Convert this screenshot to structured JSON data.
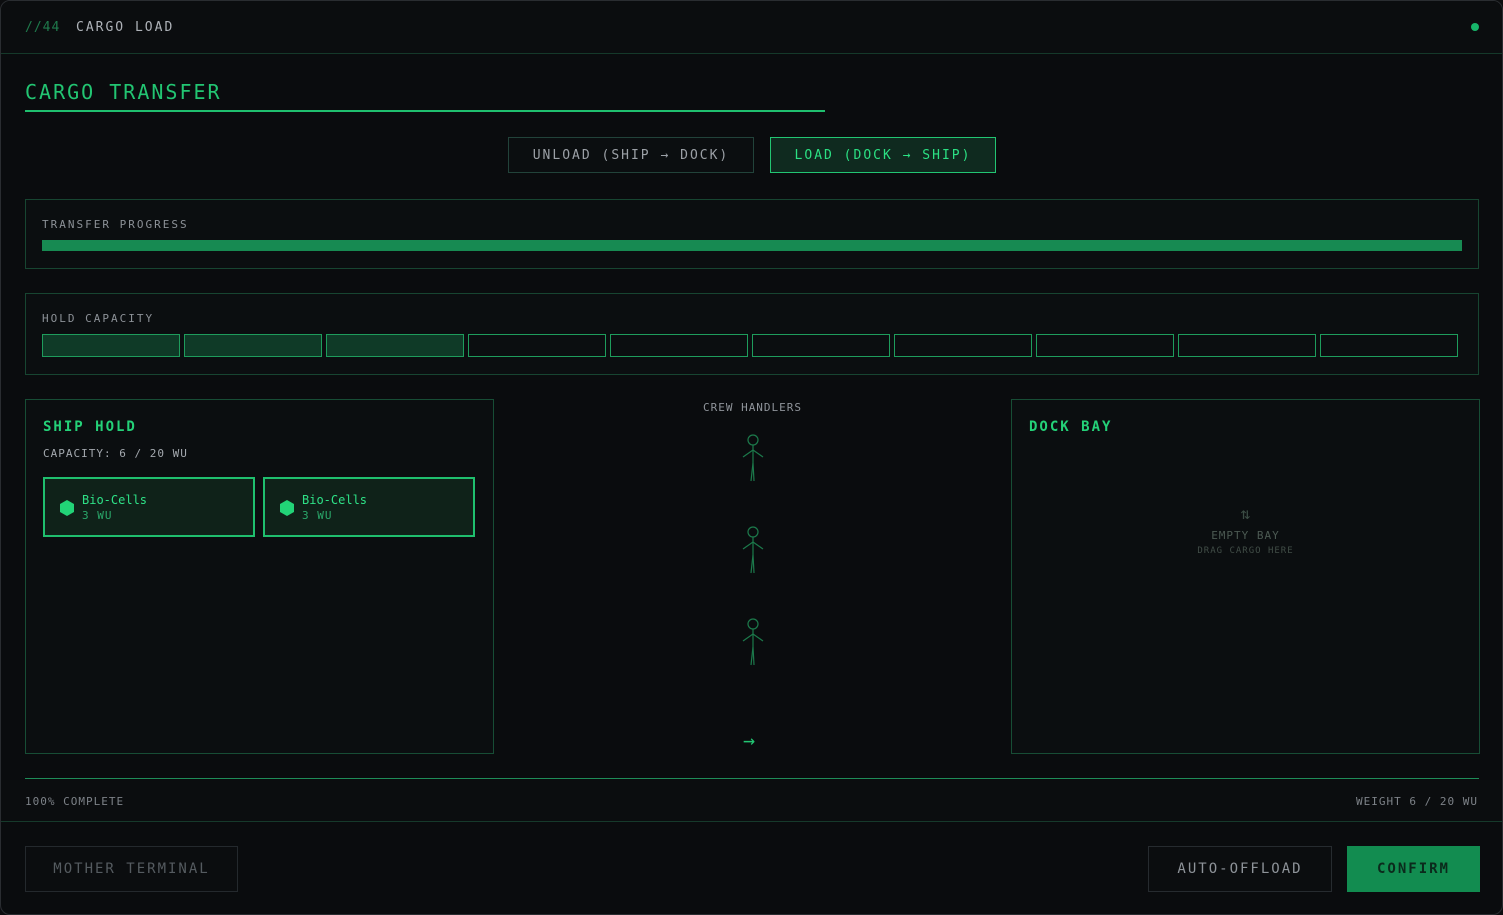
{
  "titlebar": {
    "code": "//44",
    "title": "CARGO LOAD"
  },
  "heading": "CARGO TRANSFER",
  "modes": {
    "unload": "UNLOAD (SHIP → DOCK)",
    "load": "LOAD (DOCK → SHIP)",
    "active": "load"
  },
  "progress": {
    "label": "TRANSFER PROGRESS",
    "value_percent": 100
  },
  "capacity": {
    "label": "HOLD CAPACITY",
    "cells_total": 10,
    "cells_filled": 3
  },
  "ship_hold": {
    "title": "SHIP HOLD",
    "capacity_text": "CAPACITY: 6 / 20 WU",
    "items": [
      {
        "name": "Bio-Cells",
        "weight": "3 WU"
      },
      {
        "name": "Bio-Cells",
        "weight": "3 WU"
      }
    ]
  },
  "crew": {
    "label": "CREW HANDLERS",
    "count": 3,
    "direction_icon": "→"
  },
  "dock_bay": {
    "title": "DOCK BAY",
    "empty_icon": "⇅",
    "empty_title": "EMPTY BAY",
    "empty_hint": "DRAG CARGO HERE"
  },
  "status": {
    "left": "100% COMPLETE",
    "right": "WEIGHT 6 / 20 WU"
  },
  "buttons": {
    "mother": "MOTHER TERMINAL",
    "auto": "AUTO-OFFLOAD",
    "confirm": "CONFIRM"
  },
  "colors": {
    "accent": "#22c572",
    "background": "#0a0c0e",
    "panel_border": "#174531"
  }
}
